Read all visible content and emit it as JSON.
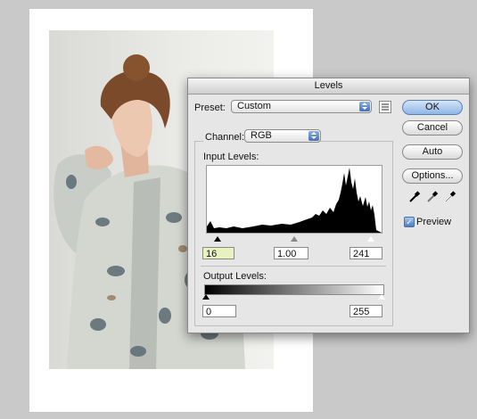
{
  "dialog": {
    "title": "Levels"
  },
  "preset": {
    "label": "Preset:",
    "value": "Custom"
  },
  "channel": {
    "label": "Channel:",
    "value": "RGB"
  },
  "input_levels": {
    "label": "Input Levels:",
    "black": "16",
    "gamma": "1.00",
    "white": "241"
  },
  "output_levels": {
    "label": "Output Levels:",
    "black": "0",
    "white": "255"
  },
  "buttons": {
    "ok": "OK",
    "cancel": "Cancel",
    "auto": "Auto",
    "options": "Options..."
  },
  "preview": {
    "label": "Preview",
    "checked": true,
    "check_glyph": "✓"
  },
  "icons": {
    "preset_menu": "preset-options-menu-icon",
    "eyedroppers": [
      "black-point-eyedropper-icon",
      "gray-point-eyedropper-icon",
      "white-point-eyedropper-icon"
    ]
  }
}
